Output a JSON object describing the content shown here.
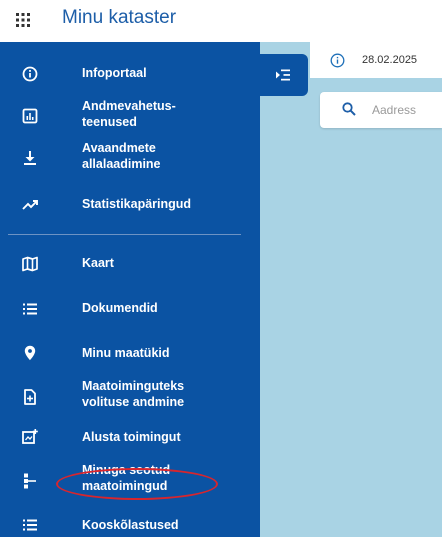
{
  "app": {
    "title": "Minu kataster",
    "apps_icon": "grid-icon"
  },
  "sidebar": {
    "items": [
      {
        "label": "Infoportaal",
        "icon": "info-circle-icon"
      },
      {
        "label": "Andmevahetus-\nteenused",
        "icon": "chart-box-icon"
      },
      {
        "label": "Avaandmete\nallalaadimine",
        "icon": "download-icon"
      },
      {
        "label": "Statistikapäringud",
        "icon": "trending-up-icon"
      },
      {
        "label": "Kaart",
        "icon": "map-icon"
      },
      {
        "label": "Dokumendid",
        "icon": "list-icon"
      },
      {
        "label": "Minu maatükid",
        "icon": "location-pin-icon"
      },
      {
        "label": "Maatoiminguteks\nvolituse andmine",
        "icon": "document-plus-icon"
      },
      {
        "label": "Alusta toimingut",
        "icon": "screen-plus-icon"
      },
      {
        "label": "Minuga seotud\nmaatoimingud",
        "icon": "tree-structure-icon"
      },
      {
        "label": "Kooskõlastused",
        "icon": "list-icon"
      }
    ]
  },
  "infobar": {
    "date": "28.02.2025",
    "icon": "info-circle-icon"
  },
  "search": {
    "placeholder": "Aadress",
    "icon": "search-icon"
  },
  "colors": {
    "sidebar": "#0b53a3",
    "map": "#a9d3e4",
    "title": "#1d5ea8",
    "highlight": "#d7262e"
  }
}
